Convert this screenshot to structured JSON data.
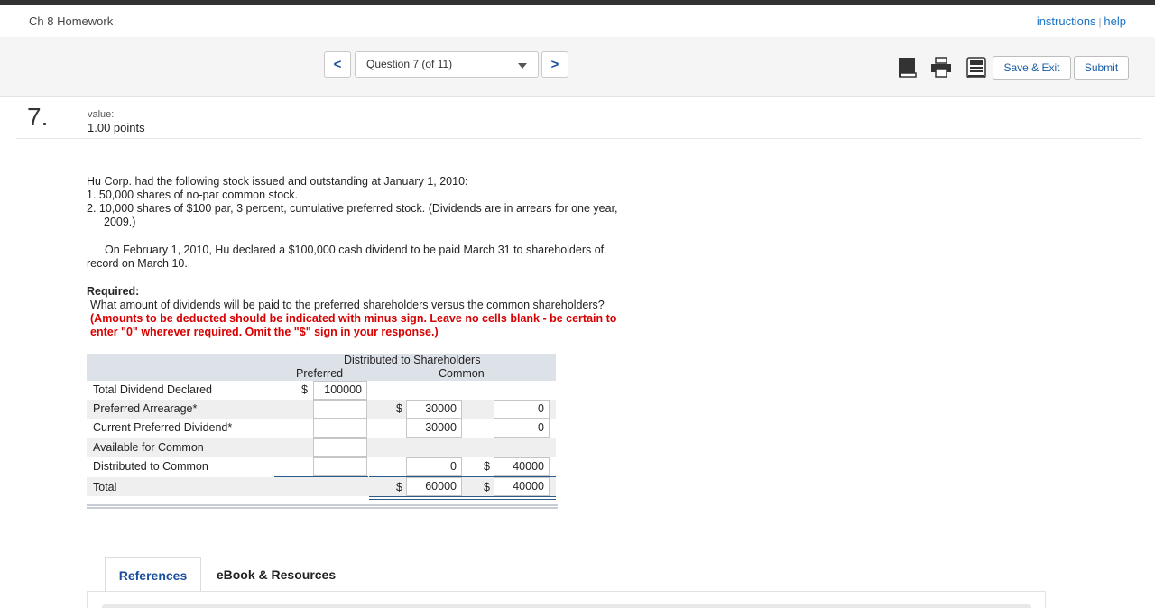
{
  "header": {
    "title": "Ch 8 Homework",
    "instructions_link": "instructions",
    "separator": "|",
    "help_link": "help"
  },
  "nav": {
    "prev_label": "<",
    "next_label": ">",
    "question_selector": "Question 7 (of 11)",
    "save_exit": "Save & Exit",
    "submit": "Submit",
    "icons": [
      "book-icon",
      "print-icon",
      "calculator-icon"
    ]
  },
  "question": {
    "number": "7.",
    "value_label": "value:",
    "value": "1.00 points",
    "intro": "Hu Corp. had the following stock issued and outstanding at January 1, 2010:",
    "item1": "1.  50,000 shares of no-par common stock.",
    "item2": "2.  10,000 shares of $100 par, 3 percent, cumulative preferred stock. (Dividends are in arrears for one year, 2009.)",
    "paragraph": "On February 1, 2010, Hu declared a $100,000 cash dividend to be paid March 31 to shareholders of record on March 10.",
    "required_label": "Required:",
    "required_text": "What amount of dividends will be paid to the preferred shareholders versus the common shareholders?",
    "instructions_line1": "(Amounts to be deducted should be indicated with minus sign. Leave no cells blank - be certain to",
    "instructions_line2": "enter \"0\" wherever required. Omit the \"$\" sign in your response.)"
  },
  "table": {
    "heading": "Distributed to Shareholders",
    "col_preferred": "Preferred",
    "col_common": "Common",
    "dollar": "$",
    "rows": [
      {
        "label": "Total Dividend Declared",
        "input": "100000",
        "preferred": "",
        "common": ""
      },
      {
        "label": "Preferred Arrearage*",
        "input": "",
        "preferred": "30000",
        "common": "0"
      },
      {
        "label": "Current Preferred Dividend*",
        "input": "",
        "preferred": "30000",
        "common": "0"
      },
      {
        "label": "Available for Common",
        "input": "",
        "preferred": "",
        "common": ""
      },
      {
        "label": "Distributed to Common",
        "input": "",
        "preferred": "0",
        "common": "40000"
      },
      {
        "label": "Total",
        "input": "",
        "preferred": "60000",
        "common": "40000"
      }
    ]
  },
  "tabs": {
    "references": "References",
    "ebook": "eBook & Resources"
  },
  "colors": {
    "link": "#1a73c8",
    "accent": "#1a4f9c",
    "warning": "#d80000",
    "table_header": "#dde1e8"
  }
}
